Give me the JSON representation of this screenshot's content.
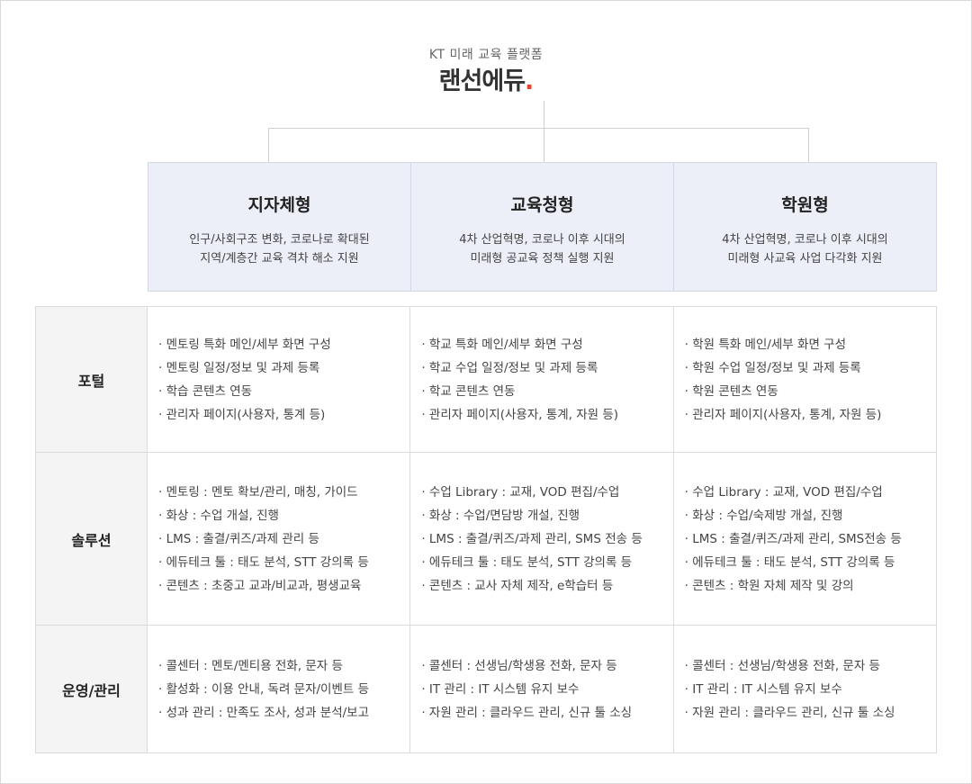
{
  "header": {
    "subtitle": "KT 미래 교육 플랫폼",
    "logo_text": "랜선에듀",
    "logo_dot": ".",
    "accent_color": "#e8452b"
  },
  "categories": [
    {
      "title": "지자체형",
      "desc_line1": "인구/사회구조 변화, 코로나로 확대된",
      "desc_line2": "지역/계층간 교육 격차 해소 지원"
    },
    {
      "title": "교육청형",
      "desc_line1": "4차 산업혁명, 코로나 이후 시대의",
      "desc_line2": "미래형 공교육 정책 실행 지원"
    },
    {
      "title": "학원형",
      "desc_line1": "4차 산업혁명, 코로나 이후 시대의",
      "desc_line2": "미래형 사교육 사업 다각화 지원"
    }
  ],
  "rows": [
    {
      "label": "포털",
      "cells": [
        [
          "· 멘토링 특화 메인/세부 화면 구성",
          "· 멘토링 일정/정보 및 과제 등록",
          "· 학습 콘텐츠 연동",
          "· 관리자 페이지(사용자, 통계 등)"
        ],
        [
          "· 학교 특화 메인/세부 화면 구성",
          "· 학교 수업 일정/정보 및 과제 등록",
          "· 학교 콘텐츠 연동",
          "· 관리자 페이지(사용자, 통계,  자원 등)"
        ],
        [
          "· 학원 특화 메인/세부 화면 구성",
          "· 학원 수업 일정/정보 및 과제 등록",
          "· 학원 콘텐츠 연동",
          "· 관리자 페이지(사용자, 통계,  자원 등)"
        ]
      ]
    },
    {
      "label": "솔루션",
      "cells": [
        [
          "· 멘토링 :  멘토 확보/관리, 매칭, 가이드",
          "· 화상 : 수업 개설, 진행",
          "· LMS : 출결/퀴즈/과제 관리 등",
          "· 에듀테크 툴 : 태도 분석, STT 강의록 등",
          "· 콘텐츠 : 초중고 교과/비교과, 평생교육"
        ],
        [
          "· 수업 Library :  교재, VOD 편집/수업",
          "· 화상 : 수업/면담방 개설, 진행",
          "· LMS : 출결/퀴즈/과제 관리, SMS 전송 등",
          "· 에듀테크 툴 : 태도 분석, STT 강의록 등",
          "· 콘텐츠 : 교사 자체 제작, e학습터 등"
        ],
        [
          "· 수업 Library :  교재, VOD 편집/수업",
          "· 화상 : 수업/숙제방 개설, 진행",
          "· LMS : 출결/퀴즈/과제 관리, SMS전송 등",
          "· 에듀테크 툴 : 태도 분석, STT 강의록 등",
          "· 콘텐츠 : 학원 자체 제작 및 강의"
        ]
      ]
    },
    {
      "label": "운영/관리",
      "cells": [
        [
          "· 콜센터 :  멘토/멘티용 전화, 문자 등",
          "· 활성화 : 이용 안내, 독려 문자/이벤트 등",
          "· 성과 관리 : 만족도 조사, 성과 분석/보고"
        ],
        [
          "· 콜센터 : 선생님/학생용 전화, 문자 등",
          "· IT 관리 : IT 시스템 유지 보수",
          "· 자원 관리 : 클라우드 관리, 신규 툴 소싱"
        ],
        [
          "· 콜센터 : 선생님/학생용 전화, 문자 등",
          "· IT 관리 : IT 시스템 유지 보수",
          "· 자원 관리 : 클라우드 관리, 신규 툴 소싱"
        ]
      ]
    }
  ]
}
